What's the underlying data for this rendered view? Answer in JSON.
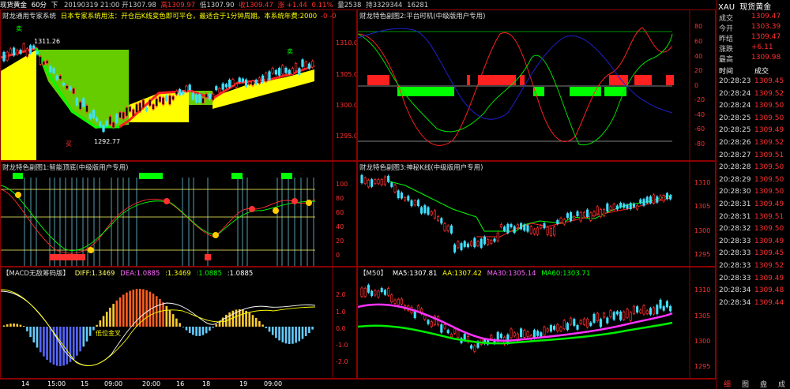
{
  "top_bar": {
    "symbol": "现货黄金",
    "period": "60分",
    "nav": "下",
    "datetime": "20190319 21:00",
    "open": "开1307.98",
    "high": "高1309.97",
    "low": "低1307.90",
    "close": "收1309.47",
    "change": "涨 +1.44",
    "pct": "0.11%",
    "volume": "量2538",
    "oi": "持3329344",
    "extra": "16281"
  },
  "main_panel": {
    "title": "财龙通用专家系统",
    "icon_label": "日本专家系统用法：开仓后K线变色即可平仓，最适合于1分钟周期。本系统年费:2000",
    "suffix": "-0 -0",
    "high_mark": "1311.26",
    "low_mark": "1292.77",
    "buy_marker": "买",
    "sell_marker": "卖",
    "y_ticks": [
      "1310.0",
      "1305.0",
      "1300.0",
      "1295.0"
    ]
  },
  "sub1": {
    "title": "财龙特色副图1:智能顶底(中级版用户专用)",
    "y_ticks": [
      "100",
      "80",
      "60",
      "40",
      "20",
      "0"
    ]
  },
  "macd": {
    "title": "【MACD无敌筹码版】",
    "diff": "DIFF:1.3469",
    "dea": "DEA:1.0885",
    "v1": ":1.3469",
    "v2": ":1.0885",
    "v3": ":1.0885",
    "note": "低位金叉",
    "y_ticks": [
      "2.0",
      "1.0",
      "0.0",
      "-1.0",
      "-2.0"
    ]
  },
  "sub2": {
    "title": "财龙特色副图2:平台时机(中级版用户专用)",
    "y_ticks": [
      "80",
      "60",
      "40",
      "20",
      "0",
      "-20",
      "-40",
      "-60",
      "-80"
    ]
  },
  "sub3": {
    "title": "财龙特色副图3:神秘K线(中级版用户专用)",
    "y_ticks": [
      "1310",
      "1305",
      "1300",
      "1295"
    ]
  },
  "m50": {
    "title": "【M50】",
    "ma5": "MA5:1307.81",
    "aa": "AA:1307.42",
    "ma30": "MA30:1305.14",
    "ma60": "MA60:1303.71",
    "y_ticks": [
      "1310",
      "1305",
      "1300",
      "1295"
    ]
  },
  "x_axis": [
    "14",
    "15:00",
    "15",
    "09:00",
    "20:00",
    "16",
    "18",
    "19",
    "09:00"
  ],
  "quote": {
    "symbol": "XAU",
    "name": "现货黄金",
    "rows": [
      {
        "label": "成交",
        "value": "1309.47",
        "color": "#ff3030"
      },
      {
        "label": "今开",
        "value": "1303.39",
        "color": "#ff3030"
      },
      {
        "label": "昨结",
        "value": "1309.47",
        "color": "#ff3030"
      },
      {
        "label": "涨跌",
        "value": "+6.11",
        "color": "#ff3030"
      },
      {
        "label": "最高",
        "value": "1309.98",
        "color": "#ff3030"
      }
    ],
    "trade_header": {
      "time": "时间",
      "price": "成交"
    },
    "trades": [
      {
        "t": "20:28:23",
        "p": "1309.45"
      },
      {
        "t": "20:28:24",
        "p": "1309.52"
      },
      {
        "t": "20:28:24",
        "p": "1309.50"
      },
      {
        "t": "20:28:25",
        "p": "1309.50"
      },
      {
        "t": "20:28:25",
        "p": "1309.49"
      },
      {
        "t": "20:28:26",
        "p": "1309.52"
      },
      {
        "t": "20:28:27",
        "p": "1309.51"
      },
      {
        "t": "20:28:28",
        "p": "1309.50"
      },
      {
        "t": "20:28:29",
        "p": "1309.50"
      },
      {
        "t": "20:28:30",
        "p": "1309.50"
      },
      {
        "t": "20:28:31",
        "p": "1309.49"
      },
      {
        "t": "20:28:31",
        "p": "1309.51"
      },
      {
        "t": "20:28:32",
        "p": "1309.50"
      },
      {
        "t": "20:28:33",
        "p": "1309.49"
      },
      {
        "t": "20:28:33",
        "p": "1309.45"
      },
      {
        "t": "20:28:33",
        "p": "1309.52"
      },
      {
        "t": "20:28:33",
        "p": "1309.49"
      },
      {
        "t": "20:28:34",
        "p": "1309.48"
      },
      {
        "t": "20:28:34",
        "p": "1309.44"
      }
    ],
    "tabs": [
      "细",
      "图",
      "盘",
      "成"
    ]
  },
  "colors": {
    "up": "#ff3030",
    "down": "#40e0ff",
    "frame": "#8b0000",
    "yellow": "#ffff00",
    "green": "#00ff00"
  }
}
